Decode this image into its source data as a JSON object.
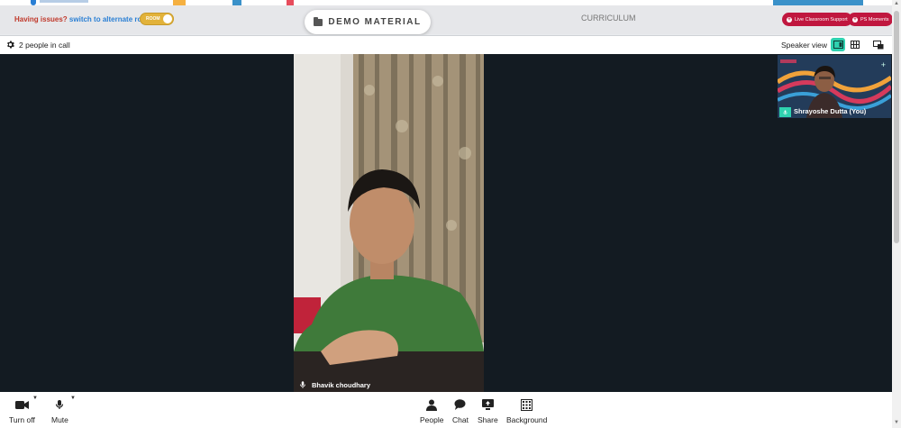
{
  "header": {
    "issues_text": "Having issues?",
    "alternate_text": "switch to alternate room",
    "toggle_label": "ROOM",
    "demo_button": "DEMO MATERIAL",
    "curriculum_tab": "CURRICULUM",
    "live_support_button": "Live Classroom Support",
    "moments_button": "PS Moments"
  },
  "call": {
    "people_count": "2 people in call",
    "view_label": "Speaker view"
  },
  "participants": {
    "main_name": "Bhavik choudhary",
    "self_name": "Shrayoshe Dutta (You)"
  },
  "controls": [
    {
      "label": "Turn off",
      "icon": "camera-icon"
    },
    {
      "label": "Mute",
      "icon": "microphone-icon"
    },
    {
      "label": "People",
      "icon": "person-icon"
    },
    {
      "label": "Chat",
      "icon": "chat-icon"
    },
    {
      "label": "Share",
      "icon": "share-screen-icon"
    },
    {
      "label": "Background",
      "icon": "background-icon"
    }
  ],
  "colors": {
    "accent": "#2fd2b0",
    "brand_red": "#c0173f",
    "stage_bg": "#131b22",
    "toggle": "#e2b23a"
  }
}
